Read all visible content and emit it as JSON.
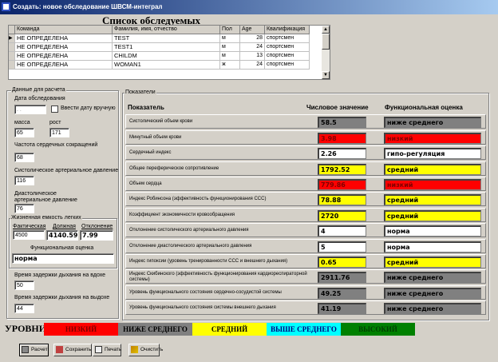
{
  "window": {
    "title": "Создать: новое обследование ШВСМ-интеграл"
  },
  "list": {
    "title": "Список обследуемых",
    "columns": [
      "Команда",
      "Фамилия, имя, отчество",
      "Пол",
      "Age",
      "Квалификация"
    ],
    "rows": [
      [
        "НЕ ОПРЕДЕЛЕНА",
        "TEST",
        "м",
        "28",
        "спортсмен"
      ],
      [
        "НЕ ОПРЕДЕЛЕНА",
        "TEST1",
        "м",
        "24",
        "спортсмен"
      ],
      [
        "НЕ ОПРЕДЕЛЕНА",
        "CHILDM",
        "м",
        "13",
        "спортсмен"
      ],
      [
        "НЕ ОПРЕДЕЛЕНА",
        "WOMAN1",
        "ж",
        "24",
        "спортсмен"
      ]
    ]
  },
  "input": {
    "group_label": "Данные для расчета",
    "date_label": "Дата обследования",
    "date_value": " . .",
    "manual_date_label": "Ввести дату вручную",
    "mass_label": "масса",
    "mass": "65",
    "height_label": "рост",
    "height": "171",
    "hr_label": "Частота сердечных сокращений",
    "hr": "68",
    "sbp_label": "Систолическое артериальное давление",
    "sbp": "116",
    "dbp_label": "Диастолическое артериальное давление",
    "dbp": "76",
    "vc_label": "Жизненная емкость легких",
    "vc_actual_label": "Фактическая",
    "vc_actual": "4500",
    "vc_due_label": "Должная",
    "vc_due": "4140.59",
    "vc_dev_label": "Отклонение",
    "vc_dev": "7.99",
    "vc_rating_label": "Функциональная оценка",
    "vc_rating": "норма",
    "breath_in_label": "Время задержки дыхания на вдохе",
    "breath_in": "50",
    "breath_out_label": "Время задержки дыхания на выдохе",
    "breath_out": "44"
  },
  "indicators": {
    "group_label": "Показатели",
    "col_name": "Показатель",
    "col_value": "Числовое значение",
    "col_rating": "Функциональная оценка",
    "rows": [
      {
        "name": "Систолический объем крови",
        "value": "58.5",
        "rating": "ниже среднего",
        "color": "#808080",
        "text": "#000"
      },
      {
        "name": "Минутный объем крови",
        "value": "3.98",
        "rating": "низкий",
        "color": "#ff0000",
        "text": "#800000"
      },
      {
        "name": "Сердечный индекс",
        "value": "2.26",
        "rating": "гипо-регуляция",
        "color": "#ffffff",
        "text": "#000"
      },
      {
        "name": "Общее переферическое сопротивление",
        "value": "1792.52",
        "rating": "средний",
        "color": "#ffff00",
        "text": "#000"
      },
      {
        "name": "Объем сердца",
        "value": "779.86",
        "rating": "низкий",
        "color": "#ff0000",
        "text": "#800000"
      },
      {
        "name": "Индекс Робинсона   (эффективность функционирования ССС)",
        "value": "78.88",
        "rating": "средний",
        "color": "#ffff00",
        "text": "#000"
      },
      {
        "name": "Коэффициент экономичности кровообращения",
        "value": "2720",
        "rating": "средний",
        "color": "#ffff00",
        "text": "#000"
      },
      {
        "name": "Отклонение систолического артериального давления",
        "value": "4",
        "rating": "норма",
        "color": "#ffffff",
        "text": "#000"
      },
      {
        "name": "Отклонение диастолического артериального давления",
        "value": "5",
        "rating": "норма",
        "color": "#ffffff",
        "text": "#000"
      },
      {
        "name": "Индекс гипоксии   (уровень тренированности ССС и внешнего дыхания)",
        "value": "0.65",
        "rating": "средний",
        "color": "#ffff00",
        "text": "#000"
      },
      {
        "name": "Индекс Скибинского   (эффективность функционирования кардиореспираторной системы)",
        "value": "2911.76",
        "rating": "ниже среднего",
        "color": "#808080",
        "text": "#000"
      },
      {
        "name": "Уровень функционального состояния сердечно-сосудистой системы",
        "value": "49.25",
        "rating": "ниже среднего",
        "color": "#808080",
        "text": "#000"
      },
      {
        "name": "Уровень функционального состояния системы внешнего дыхания",
        "value": "41.19",
        "rating": "ниже среднего",
        "color": "#808080",
        "text": "#000"
      }
    ]
  },
  "levels": {
    "label": "УРОВНИ",
    "items": [
      {
        "label": "НИЗКИЙ",
        "color": "#ff0000",
        "text": "#800000"
      },
      {
        "label": "НИЖЕ СРЕДНЕГО",
        "color": "#808080",
        "text": "#000"
      },
      {
        "label": "СРЕДНИЙ",
        "color": "#ffff00",
        "text": "#000"
      },
      {
        "label": "ВЫШЕ  СРЕДНЕГО",
        "color": "#00ffff",
        "text": "#000080"
      },
      {
        "label": "ВЫСОКИЙ",
        "color": "#008000",
        "text": "#004000"
      }
    ]
  },
  "buttons": {
    "calc": "Расчет",
    "save": "Сохранить",
    "print": "Печать",
    "clear": "Очистить"
  }
}
